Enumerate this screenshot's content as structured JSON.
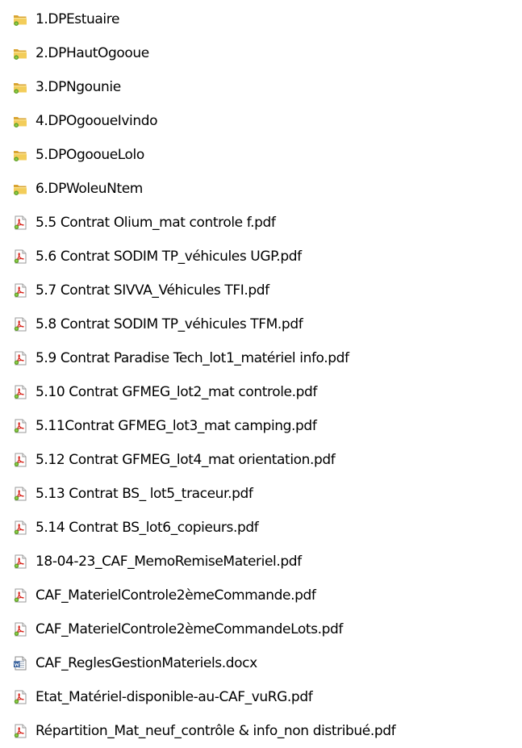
{
  "files": [
    {
      "name": "1.DPEstuaire",
      "icon": "folder-icon"
    },
    {
      "name": "2.DPHautOgooue",
      "icon": "folder-icon"
    },
    {
      "name": "3.DPNgounie",
      "icon": "folder-icon"
    },
    {
      "name": "4.DPOgooueIvindo",
      "icon": "folder-icon"
    },
    {
      "name": "5.DPOgooueLolo",
      "icon": "folder-icon"
    },
    {
      "name": "6.DPWoleuNtem",
      "icon": "folder-icon"
    },
    {
      "name": "5.5 Contrat Olium_mat controle f.pdf",
      "icon": "pdf-file-icon"
    },
    {
      "name": "5.6 Contrat SODIM TP_véhicules UGP.pdf",
      "icon": "pdf-file-icon"
    },
    {
      "name": "5.7 Contrat SIVVA_Véhicules TFI.pdf",
      "icon": "pdf-file-icon"
    },
    {
      "name": "5.8 Contrat SODIM TP_véhicules TFM.pdf",
      "icon": "pdf-file-icon"
    },
    {
      "name": "5.9 Contrat Paradise Tech_lot1_matériel info.pdf",
      "icon": "pdf-file-icon"
    },
    {
      "name": "5.10 Contrat GFMEG_lot2_mat controle.pdf",
      "icon": "pdf-file-icon"
    },
    {
      "name": "5.11Contrat GFMEG_lot3_mat camping.pdf",
      "icon": "pdf-file-icon"
    },
    {
      "name": "5.12 Contrat GFMEG_lot4_mat orientation.pdf",
      "icon": "pdf-file-icon"
    },
    {
      "name": "5.13 Contrat BS_ lot5_traceur.pdf",
      "icon": "pdf-file-icon"
    },
    {
      "name": "5.14 Contrat BS_lot6_copieurs.pdf",
      "icon": "pdf-file-icon"
    },
    {
      "name": "18-04-23_CAF_MemoRemiseMateriel.pdf",
      "icon": "pdf-file-icon"
    },
    {
      "name": "CAF_MaterielControle2èmeCommande.pdf",
      "icon": "pdf-file-icon"
    },
    {
      "name": "CAF_MaterielControle2èmeCommandeLots.pdf",
      "icon": "pdf-file-icon"
    },
    {
      "name": "CAF_ReglesGestionMateriels.docx",
      "icon": "word-document-icon"
    },
    {
      "name": "Etat_Matériel-disponible-au-CAF_vuRG.pdf",
      "icon": "pdf-file-icon"
    },
    {
      "name": "Répartition_Mat_neuf_contrôle & info_non distribué.pdf",
      "icon": "pdf-file-icon"
    }
  ]
}
